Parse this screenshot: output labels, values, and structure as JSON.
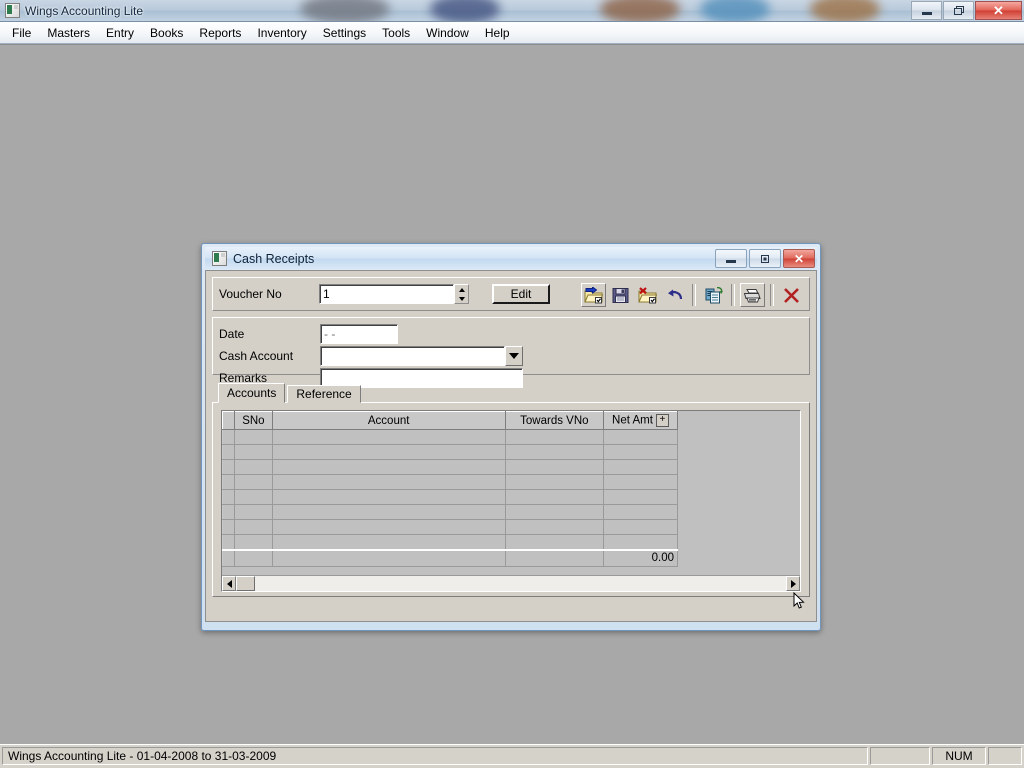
{
  "app": {
    "title": "Wings Accounting Lite",
    "title_icon": "app-icon",
    "window_controls": [
      {
        "name": "minimize-button",
        "glyph": "minimize-icon"
      },
      {
        "name": "maximize-button",
        "glyph": "maximize-icon"
      },
      {
        "name": "close-button",
        "glyph": "close-icon",
        "label": "✕",
        "color": "#cf3f33"
      }
    ],
    "menu": [
      {
        "label": "File"
      },
      {
        "label": "Masters"
      },
      {
        "label": "Entry"
      },
      {
        "label": "Books"
      },
      {
        "label": "Reports"
      },
      {
        "label": "Inventory"
      },
      {
        "label": "Settings"
      },
      {
        "label": "Tools"
      },
      {
        "label": "Window"
      },
      {
        "label": "Help"
      }
    ],
    "desktop_color": "#a8a8a8"
  },
  "statusbar": {
    "main": "Wings Accounting Lite -  01-04-2008 to 31-03-2009",
    "pane2": "",
    "num": "NUM",
    "pane4": ""
  },
  "dialog": {
    "title": "Cash Receipts",
    "title_icon": "document-icon",
    "window_controls": [
      {
        "name": "minimize-button",
        "glyph": "minimize-icon"
      },
      {
        "name": "restore-button",
        "glyph": "restore-icon"
      },
      {
        "name": "close-button",
        "glyph": "close-icon",
        "label": "✕"
      }
    ],
    "voucher": {
      "label": "Voucher No",
      "value": "1",
      "placeholder": "",
      "spinner_up": "▲",
      "spinner_down": "▼",
      "edit_button": "Edit"
    },
    "toolbar": [
      {
        "name": "new-voucher-button",
        "icon": "new-folder-arrow-icon",
        "state": "raised"
      },
      {
        "name": "save-button",
        "icon": "floppy-disk-icon",
        "state": "flat"
      },
      {
        "name": "delete-button",
        "icon": "folder-delete-icon",
        "state": "flat"
      },
      {
        "name": "undo-button",
        "icon": "undo-arrow-icon",
        "state": "flat"
      },
      {
        "name": "copy-voucher-button",
        "icon": "copy-document-icon",
        "state": "flat"
      },
      {
        "name": "print-button",
        "icon": "printer-icon",
        "state": "raised"
      },
      {
        "name": "close-form-button",
        "icon": "red-x-icon",
        "state": "flat"
      }
    ],
    "fields": [
      {
        "name": "date-field",
        "label": "Date",
        "value": "-  -",
        "placeholder": "-  -",
        "type": "date-mask"
      },
      {
        "name": "cash-account-field",
        "label": "Cash Account",
        "value": "",
        "placeholder": "",
        "type": "combobox"
      },
      {
        "name": "remarks-field",
        "label": "Remarks",
        "value": "",
        "placeholder": "",
        "type": "text"
      }
    ],
    "tabs": [
      {
        "label": "Accounts",
        "active": true
      },
      {
        "label": "Reference",
        "active": false
      }
    ],
    "grid": {
      "columns": [
        "",
        "SNo",
        "Account",
        "Towards VNo",
        "Net Amt"
      ],
      "net_amt_plus": "+",
      "rows": [
        [
          "",
          "",
          "",
          "",
          ""
        ],
        [
          "",
          "",
          "",
          "",
          ""
        ],
        [
          "",
          "",
          "",
          "",
          ""
        ],
        [
          "",
          "",
          "",
          "",
          ""
        ],
        [
          "",
          "",
          "",
          "",
          ""
        ],
        [
          "",
          "",
          "",
          "",
          ""
        ],
        [
          "",
          "",
          "",
          "",
          ""
        ],
        [
          "",
          "",
          "",
          "",
          ""
        ]
      ],
      "total_row": [
        "",
        "",
        "",
        "",
        "0.00"
      ]
    },
    "hscroll": {
      "left_arrow": "◀",
      "right_arrow": "▶"
    }
  }
}
